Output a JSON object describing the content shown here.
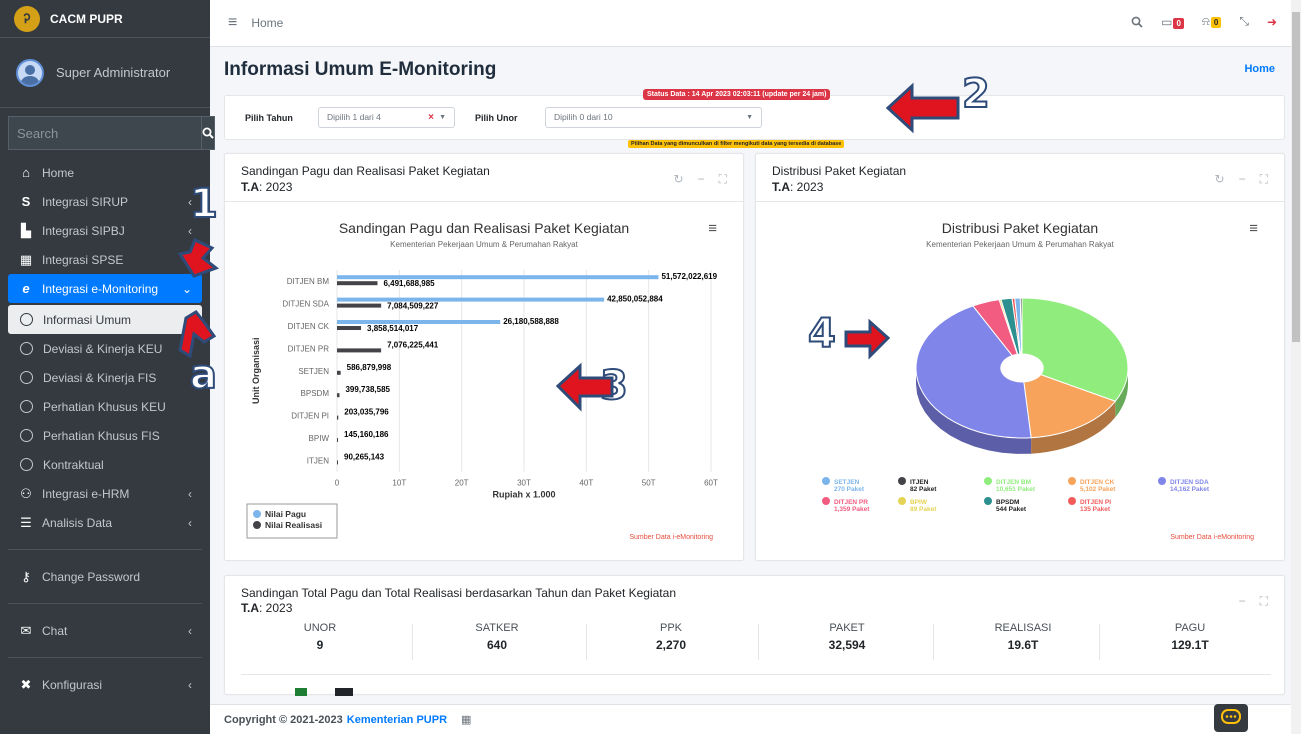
{
  "app": {
    "brand": "CACM PUPR",
    "user": "Super Administrator"
  },
  "search": {
    "placeholder": "Search"
  },
  "sidebar": {
    "items": [
      {
        "label": "Home",
        "icon": "home-icon"
      },
      {
        "label": "Integrasi SIRUP",
        "icon": "dollar-icon"
      },
      {
        "label": "Integrasi SIPBJ",
        "icon": "cart-icon"
      },
      {
        "label": "Integrasi SPSE",
        "icon": "building-icon"
      },
      {
        "label": "Integrasi e-Monitoring",
        "icon": "globe-icon"
      }
    ],
    "subitems": [
      "Informasi Umum",
      "Deviasi & Kinerja KEU",
      "Deviasi & Kinerja FIS",
      "Perhatian Khusus KEU",
      "Perhatian Khusus FIS",
      "Kontraktual"
    ],
    "more": [
      {
        "label": "Integrasi e-HRM",
        "icon": "users-icon"
      },
      {
        "label": "Analisis Data",
        "icon": "database-icon"
      }
    ],
    "bottom": [
      {
        "label": "Change Password",
        "icon": "key-icon"
      },
      {
        "label": "Chat",
        "icon": "chat-icon"
      },
      {
        "label": "Konfigurasi",
        "icon": "tools-icon"
      }
    ]
  },
  "topbar": {
    "breadcrumb": "Home",
    "badge_chat": "0",
    "badge_notif": "0"
  },
  "page": {
    "title": "Informasi Umum E-Monitoring",
    "breadcrumb_home": "Home"
  },
  "filters": {
    "status": "Status Data : 14 Apr 2023 02:03:11 (update per 24 jam)",
    "note": "Pilihan Data yang dimunculkan di filter mengikuti data yang tersedia di database",
    "tahun_label": "Pilih Tahun",
    "tahun_value": "Dipilih 1 dari 4",
    "unor_label": "Pilih Unor",
    "unor_value": "Dipilih 0 dari 10"
  },
  "card1": {
    "title": "Sandingan Pagu dan Realisasi Paket Kegiatan",
    "ta_label": "T.A",
    "ta_value": ": 2023",
    "source": "Sumber Data i-eMonitoring"
  },
  "card2": {
    "title": "Distribusi Paket Kegiatan",
    "ta_label": "T.A",
    "ta_value": ": 2023",
    "source": "Sumber Data i-eMonitoring"
  },
  "card3": {
    "title": "Sandingan Total Pagu dan Total Realisasi berdasarkan Tahun dan Paket Kegiatan",
    "ta_label": "T.A",
    "ta_value": ": 2023",
    "stats": [
      {
        "label": "UNOR",
        "value": "9"
      },
      {
        "label": "SATKER",
        "value": "640"
      },
      {
        "label": "PPK",
        "value": "2,270"
      },
      {
        "label": "PAKET",
        "value": "32,594"
      },
      {
        "label": "REALISASI",
        "value": "19.6T"
      },
      {
        "label": "PAGU",
        "value": "129.1T"
      }
    ]
  },
  "footer": {
    "text": "Copyright © 2021-2023",
    "link": "Kementerian PUPR"
  },
  "overlay_numbers": [
    "1",
    "a",
    "2",
    "3",
    "4"
  ],
  "chart_data": [
    {
      "type": "bar",
      "title": "Sandingan Pagu dan Realisasi Paket Kegiatan",
      "subtitle": "Kementerian Pekerjaan Umum & Perumahan Rakyat",
      "xlabel": "Rupiah x 1.000",
      "ylabel": "Unit Organisasi",
      "categories": [
        "DITJEN BM",
        "DITJEN SDA",
        "DITJEN CK",
        "DITJEN PR",
        "SETJEN",
        "BPSDM",
        "DITJEN PI",
        "BPIW",
        "ITJEN"
      ],
      "x_ticks": [
        "0",
        "10T",
        "20T",
        "30T",
        "40T",
        "50T",
        "60T"
      ],
      "xlim": [
        0,
        60000000000
      ],
      "series": [
        {
          "name": "Nilai Pagu",
          "color": "#7cb5ec",
          "values": [
            51572022619,
            42850052884,
            26180588888,
            null,
            null,
            null,
            null,
            null,
            null
          ],
          "labels": [
            "51,572,022,619",
            "42,850,052,884",
            "26,180,588,888",
            "",
            "",
            "",
            "",
            "",
            ""
          ]
        },
        {
          "name": "Nilai Realisasi",
          "color": "#434348",
          "values": [
            6491688985,
            7084509227,
            3858514017,
            7076225441,
            586879998,
            399738585,
            203035796,
            145160186,
            90265143
          ],
          "labels": [
            "6,491,688,985",
            "7,084,509,227",
            "3,858,514,017",
            "7,076,225,441",
            "586,879,998",
            "399,738,585",
            "203,035,796",
            "145,160,186",
            "90,265,143"
          ]
        }
      ]
    },
    {
      "type": "pie",
      "title": "Distribusi Paket Kegiatan",
      "subtitle": "Kementerian Pekerjaan Umum & Perumahan Rakyat",
      "legend": [
        {
          "name": "SETJEN",
          "value": 270,
          "label": "270 Paket",
          "color": "#7cb5ec"
        },
        {
          "name": "ITJEN",
          "value": 82,
          "label": "82 Paket",
          "color": "#434348"
        },
        {
          "name": "DITJEN BM",
          "value": 10651,
          "label": "10,651 Paket",
          "color": "#90ed7d"
        },
        {
          "name": "DITJEN CK",
          "value": 5102,
          "label": "5,102 Paket",
          "color": "#f7a35c"
        },
        {
          "name": "DITJEN SDA",
          "value": 14162,
          "label": "14,162 Paket",
          "color": "#8085e9"
        },
        {
          "name": "DITJEN PR",
          "value": 1359,
          "label": "1,359 Paket",
          "color": "#f15c80"
        },
        {
          "name": "BPIW",
          "value": 89,
          "label": "89 Paket",
          "color": "#e4d354"
        },
        {
          "name": "BPSDM",
          "value": 544,
          "label": "544 Paket",
          "color": "#2b908f"
        },
        {
          "name": "DITJEN PI",
          "value": 135,
          "label": "135 Paket",
          "color": "#f45b5b"
        }
      ]
    }
  ]
}
